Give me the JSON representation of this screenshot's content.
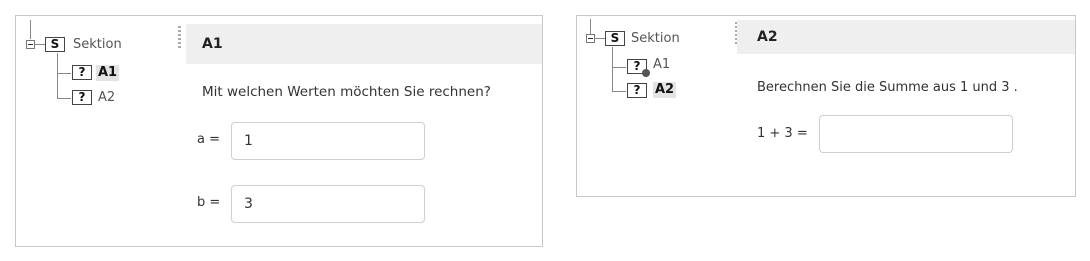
{
  "panel_a1": {
    "tree": {
      "section_icon": "S",
      "section_label": "Sektion",
      "items": [
        {
          "icon": "?",
          "label": "A1"
        },
        {
          "icon": "?",
          "label": "A2"
        }
      ]
    },
    "header_title": "A1",
    "question": "Mit welchen Werten möchten Sie rechnen?",
    "fields": [
      {
        "label": "a =",
        "value": "1"
      },
      {
        "label": "b =",
        "value": "3"
      }
    ]
  },
  "panel_a2": {
    "tree": {
      "section_icon": "S",
      "section_label": "Sektion",
      "items": [
        {
          "icon": "?",
          "label": "A1"
        },
        {
          "icon": "?",
          "label": "A2"
        }
      ]
    },
    "header_title": "A2",
    "question": "Berechnen Sie die Summe aus 1 und 3 .",
    "answer": {
      "label": "1 + 3 =",
      "value": ""
    }
  }
}
